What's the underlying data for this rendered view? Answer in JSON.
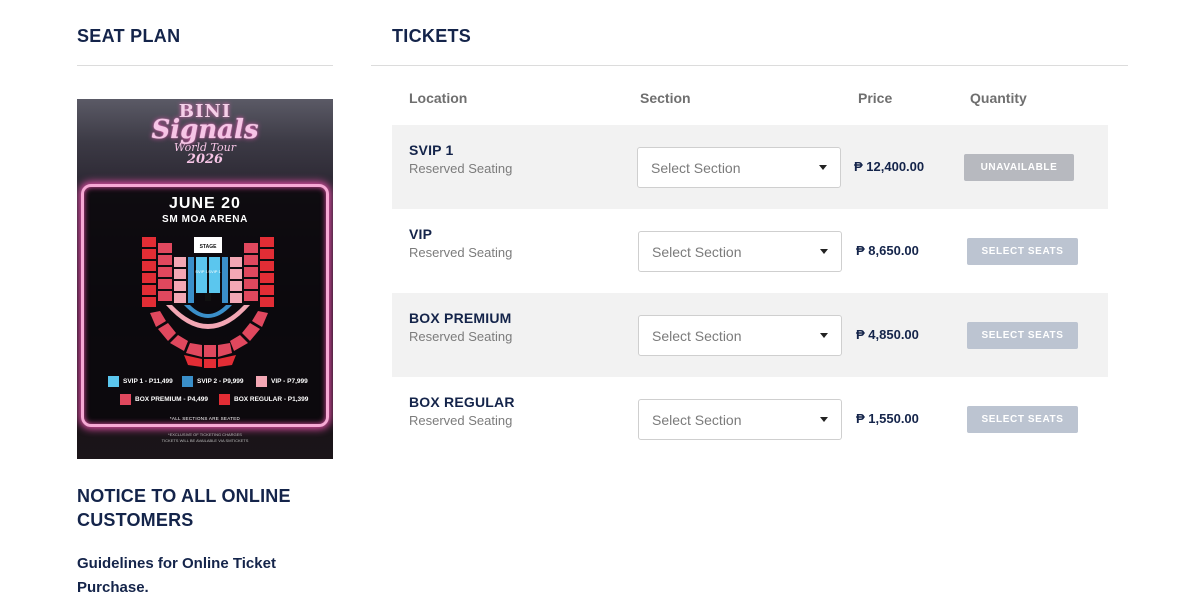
{
  "seat_plan": {
    "heading": "SEAT PLAN",
    "poster": {
      "logo_line1": "BINI",
      "logo_line2": "Signals",
      "logo_line3": "World Tour",
      "logo_line4": "2026",
      "date": "JUNE 20",
      "venue": "SM MOA ARENA",
      "stage_label": "STAGE",
      "svip1_label": "SVIP 1",
      "svip1_label_b": "SVIP 1",
      "legend": [
        {
          "label": "SVIP 1 - P11,499",
          "color": "#5bc6ee"
        },
        {
          "label": "SVIP 2 - P9,999",
          "color": "#3a8fc9"
        },
        {
          "label": "VIP - P7,999",
          "color": "#f3a7b4"
        },
        {
          "label": "BOX PREMIUM - P4,499",
          "color": "#e0485e"
        },
        {
          "label": "BOX REGULAR - P1,399",
          "color": "#e22d35"
        }
      ],
      "note": "*ALL SECTIONS ARE SEATED",
      "footer_line1": "*EXCLUSIVE OF TICKETING CHARGES",
      "footer_line2": "TICKETS WILL BE AVAILABLE VIA SMTICKETS"
    }
  },
  "notice": {
    "title": "NOTICE TO ALL ONLINE CUSTOMERS",
    "subtitle": "Guidelines for Online Ticket Purchase."
  },
  "tickets": {
    "heading": "TICKETS",
    "columns": {
      "location": "Location",
      "section": "Section",
      "price": "Price",
      "quantity": "Quantity"
    },
    "rows": [
      {
        "name": "SVIP 1",
        "seating": "Reserved Seating",
        "section_placeholder": "Select Section",
        "price": "₱ 12,400.00",
        "action": "UNAVAILABLE",
        "available": false
      },
      {
        "name": "VIP",
        "seating": "Reserved Seating",
        "section_placeholder": "Select Section",
        "price": "₱ 8,650.00",
        "action": "SELECT SEATS",
        "available": true
      },
      {
        "name": "BOX PREMIUM",
        "seating": "Reserved Seating",
        "section_placeholder": "Select Section",
        "price": "₱ 4,850.00",
        "action": "SELECT SEATS",
        "available": true
      },
      {
        "name": "BOX REGULAR",
        "seating": "Reserved Seating",
        "section_placeholder": "Select Section",
        "price": "₱ 1,550.00",
        "action": "SELECT SEATS",
        "available": true
      }
    ]
  },
  "colors": {
    "heading": "#14244a",
    "row_shade": "#f2f2f2",
    "unavailable_button": "#b7b9bf",
    "select_button": "#bcc4d1",
    "poster_glow": "#e44fa7"
  }
}
